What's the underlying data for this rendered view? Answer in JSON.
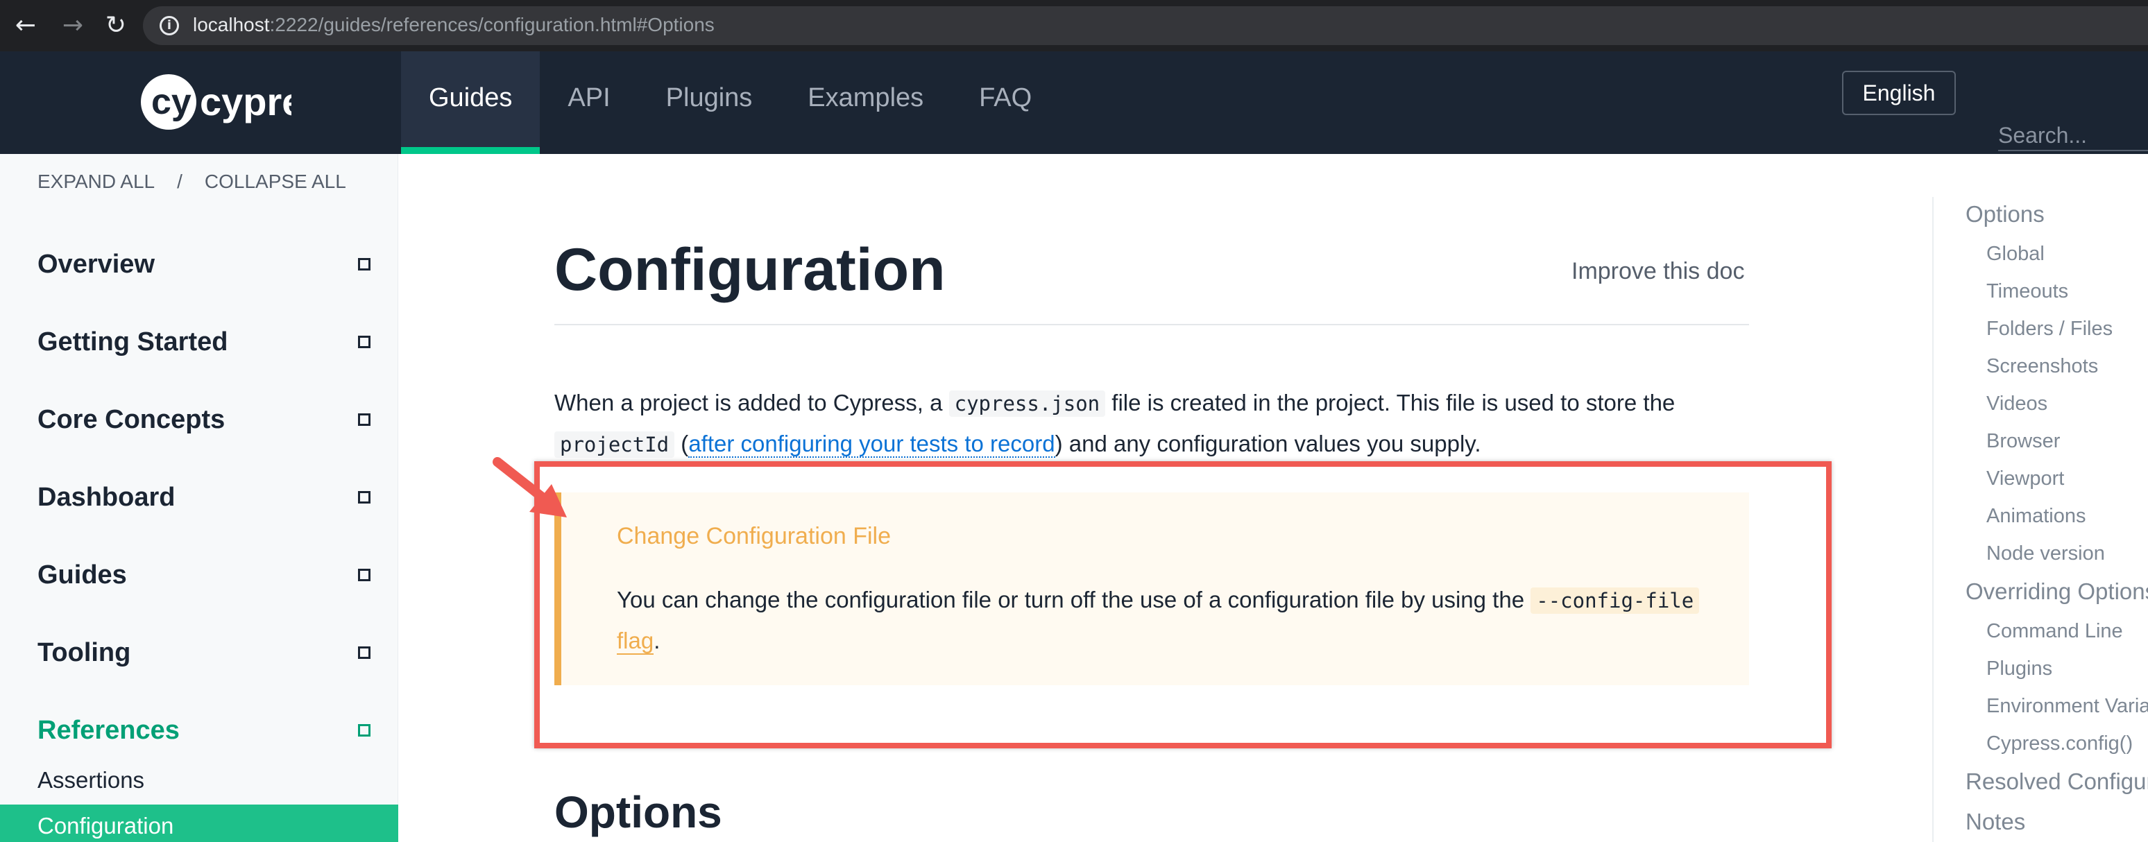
{
  "browser": {
    "url_host": "localhost",
    "url_rest": ":2222/guides/references/configuration.html#Options",
    "icons": {
      "back": "arrow-left-icon",
      "forward": "arrow-right-icon",
      "reload": "reload-icon",
      "info": "info-icon"
    }
  },
  "header": {
    "logo_text": "cypress",
    "tabs": [
      {
        "label": "Guides",
        "active": true
      },
      {
        "label": "API",
        "active": false
      },
      {
        "label": "Plugins",
        "active": false
      },
      {
        "label": "Examples",
        "active": false
      },
      {
        "label": "FAQ",
        "active": false
      }
    ],
    "language": "English",
    "search_placeholder": "Search..."
  },
  "sidebar": {
    "expand_all": "EXPAND ALL",
    "separator": "/",
    "collapse_all": "COLLAPSE ALL",
    "sections": [
      {
        "label": "Overview",
        "current": false
      },
      {
        "label": "Getting Started",
        "current": false
      },
      {
        "label": "Core Concepts",
        "current": false
      },
      {
        "label": "Dashboard",
        "current": false
      },
      {
        "label": "Guides",
        "current": false
      },
      {
        "label": "Tooling",
        "current": false
      },
      {
        "label": "References",
        "current": true
      }
    ],
    "sub_items": [
      {
        "label": "Assertions",
        "active": false
      },
      {
        "label": "Configuration",
        "active": true
      }
    ]
  },
  "main": {
    "title": "Configuration",
    "improve_link": "Improve this doc",
    "intro": {
      "t1": "When a project is added to Cypress, a ",
      "code1": "cypress.json",
      "t2": " file is created in the project. This file is used to store the ",
      "code2": "projectId",
      "t3": " (",
      "link": "after configuring your tests to record",
      "t4": ") and any configuration values you supply."
    },
    "callout": {
      "title": "Change Configuration File",
      "body_text": "You can change the configuration file or turn off the use of a configuration file by using the ",
      "code": "--config-file",
      "link": "flag",
      "end": "."
    },
    "section_heading": "Options"
  },
  "toc": {
    "items": [
      {
        "label": "Options",
        "level": 1
      },
      {
        "label": "Global",
        "level": 2
      },
      {
        "label": "Timeouts",
        "level": 2
      },
      {
        "label": "Folders / Files",
        "level": 2
      },
      {
        "label": "Screenshots",
        "level": 2
      },
      {
        "label": "Videos",
        "level": 2
      },
      {
        "label": "Browser",
        "level": 2
      },
      {
        "label": "Viewport",
        "level": 2
      },
      {
        "label": "Animations",
        "level": 2
      },
      {
        "label": "Node version",
        "level": 2
      },
      {
        "label": "Overriding Options",
        "level": 1
      },
      {
        "label": "Command Line",
        "level": 2
      },
      {
        "label": "Plugins",
        "level": 2
      },
      {
        "label": "Environment Variables",
        "level": 2
      },
      {
        "label": "Cypress.config()",
        "level": 2
      },
      {
        "label": "Resolved Configuration",
        "level": 1
      },
      {
        "label": "Notes",
        "level": 1
      }
    ]
  },
  "colors": {
    "accent": "#00c78a",
    "header_bg": "#1b2533",
    "callout_accent": "#f0ad4e",
    "annotation_red": "#f05a52",
    "link_blue": "#0b72d6"
  }
}
